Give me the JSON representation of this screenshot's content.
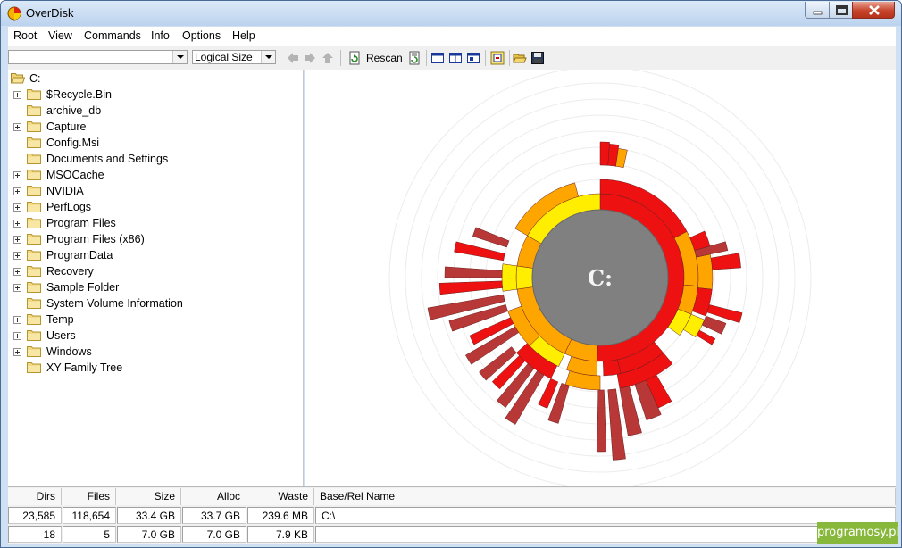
{
  "window": {
    "title": "OverDisk"
  },
  "menu": [
    "Root",
    "View",
    "Commands",
    "Info",
    "Options",
    "Help"
  ],
  "toolbar": {
    "path_value": "",
    "size_mode": "Logical Size",
    "rescan_label": "Rescan"
  },
  "tree": {
    "root": "C:",
    "items": [
      {
        "label": "$Recycle.Bin",
        "expandable": true
      },
      {
        "label": "archive_db",
        "expandable": false
      },
      {
        "label": "Capture",
        "expandable": true
      },
      {
        "label": "Config.Msi",
        "expandable": false
      },
      {
        "label": "Documents and Settings",
        "expandable": false
      },
      {
        "label": "MSOCache",
        "expandable": true
      },
      {
        "label": "NVIDIA",
        "expandable": true
      },
      {
        "label": "PerfLogs",
        "expandable": true
      },
      {
        "label": "Program Files",
        "expandable": true
      },
      {
        "label": "Program Files (x86)",
        "expandable": true
      },
      {
        "label": "ProgramData",
        "expandable": true
      },
      {
        "label": "Recovery",
        "expandable": true
      },
      {
        "label": "Sample Folder",
        "expandable": true
      },
      {
        "label": "System Volume Information",
        "expandable": false
      },
      {
        "label": "Temp",
        "expandable": true
      },
      {
        "label": "Users",
        "expandable": true
      },
      {
        "label": "Windows",
        "expandable": true
      },
      {
        "label": "XY Family Tree",
        "expandable": false
      }
    ]
  },
  "chart": {
    "center_label": "C:"
  },
  "status": {
    "headers": {
      "dirs": "Dirs",
      "files": "Files",
      "size": "Size",
      "alloc": "Alloc",
      "waste": "Waste",
      "name": "Base/Rel Name"
    },
    "rows": [
      {
        "dirs": "23,585",
        "files": "118,654",
        "size": "33.4 GB",
        "alloc": "33.7 GB",
        "waste": "239.6 MB",
        "name": "C:\\"
      },
      {
        "dirs": "18",
        "files": "5",
        "size": "7.0 GB",
        "alloc": "7.0 GB",
        "waste": "7.9 KB",
        "name": ""
      }
    ]
  },
  "watermark": "programosy.pl",
  "colors": {
    "red": "#ee1111",
    "orange": "#ffa500",
    "yellow": "#ffee00",
    "dark_red": "#b83838",
    "center": "#808080"
  }
}
